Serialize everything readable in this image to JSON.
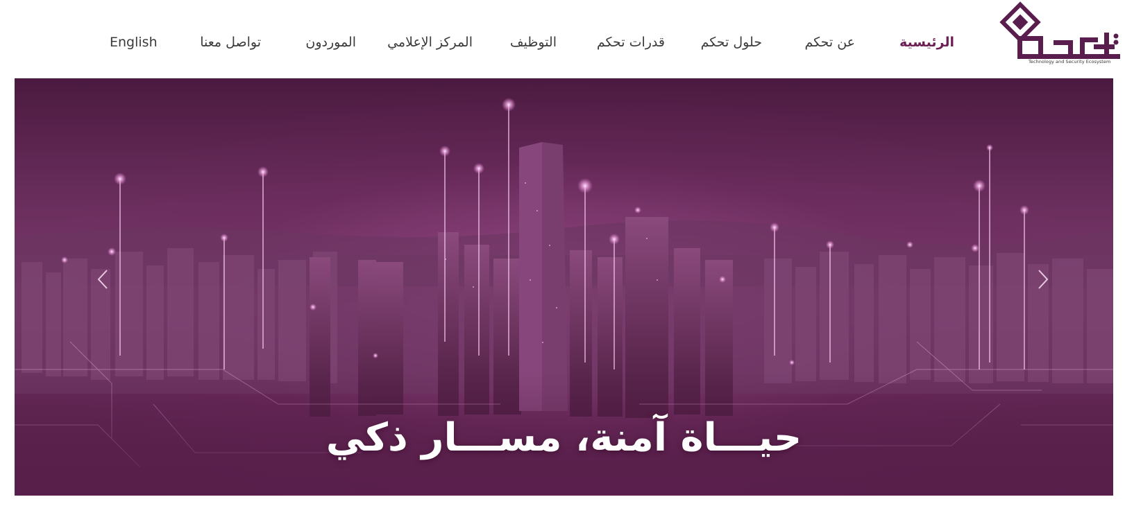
{
  "brand": {
    "logo_text": "تحكم",
    "tagline": "Technology and Security Ecosystem",
    "color": "#5a1e4e"
  },
  "nav": {
    "items": [
      {
        "label": "الرئيسية",
        "active": true
      },
      {
        "label": "عن تحكم"
      },
      {
        "label": "حلول تحكم"
      },
      {
        "label": "قدرات تحكم"
      },
      {
        "label": "التوظيف"
      },
      {
        "label": "المركز الإعلامي"
      },
      {
        "label": "الموردون"
      },
      {
        "label": "تواصل معنا"
      },
      {
        "label": "English"
      }
    ],
    "active_color": "#6b1f55",
    "text_color": "#3a3a3a"
  },
  "hero": {
    "title": "حيـــاة آمنة، مســـار ذكي",
    "prev_icon": "chevron-left-icon",
    "next_icon": "chevron-right-icon",
    "overlay_color": "#5e2450"
  }
}
